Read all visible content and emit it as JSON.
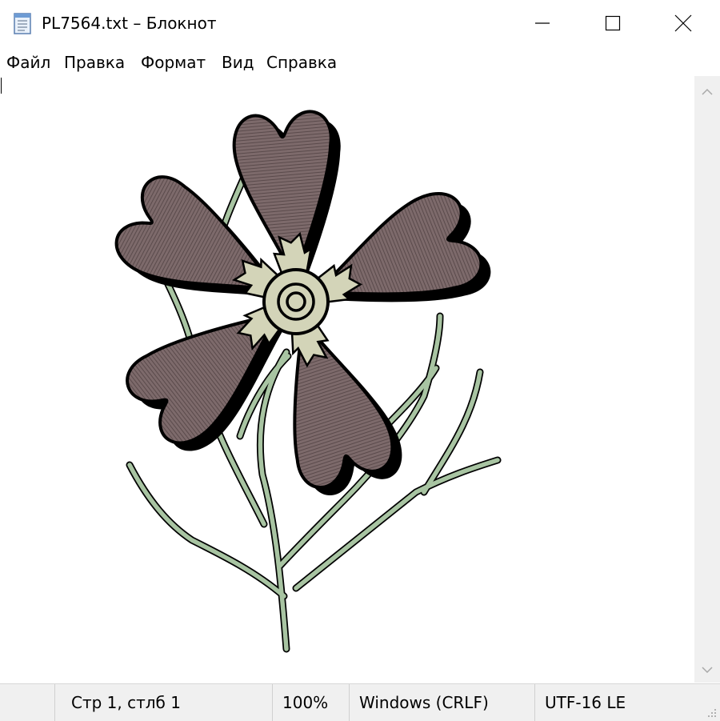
{
  "window": {
    "title": "PL7564.txt – Блокнот",
    "icons": {
      "app": "notepad-icon",
      "minimize": "minimize-icon",
      "maximize": "maximize-icon",
      "close": "close-icon"
    }
  },
  "menu": {
    "items": [
      "Файл",
      "Правка",
      "Формат",
      "Вид",
      "Справка"
    ]
  },
  "editor": {
    "content_image": "flower-illustration",
    "colors": {
      "petal": "#7d6a6b",
      "stem": "#a8c4a2",
      "center": "#d3d4b8",
      "outline": "#000000"
    }
  },
  "scrollbar": {
    "up_icon": "chevron-up-icon",
    "down_icon": "chevron-down-icon"
  },
  "status": {
    "position": "Стр 1, стлб 1",
    "zoom": "100%",
    "line_endings": "Windows (CRLF)",
    "encoding": "UTF-16 LE"
  }
}
